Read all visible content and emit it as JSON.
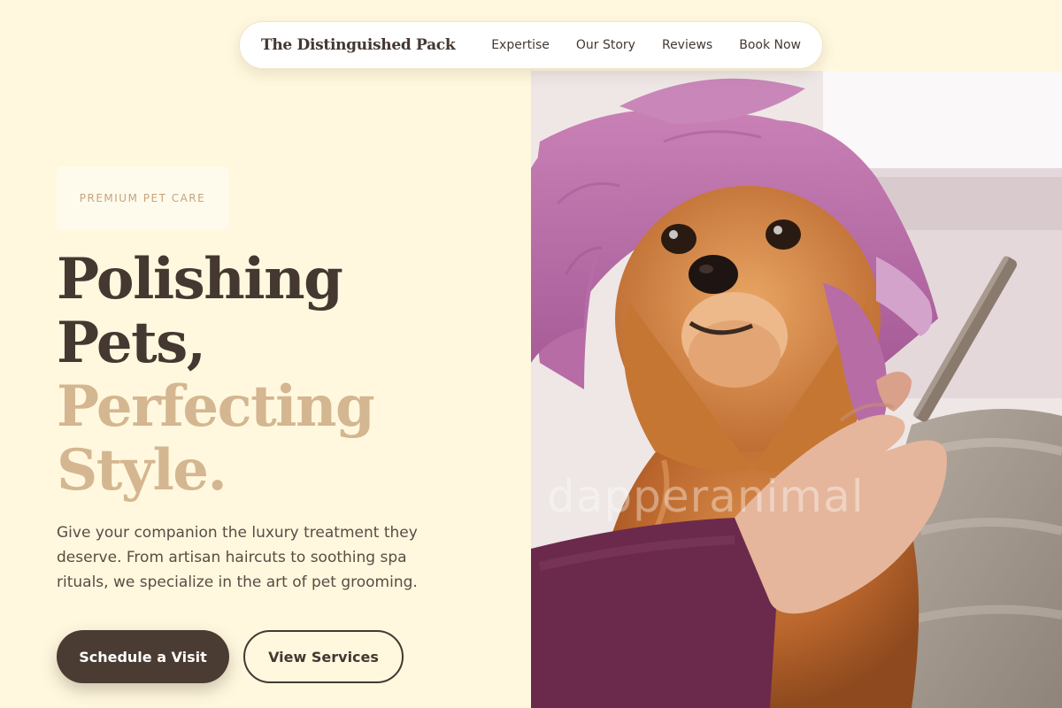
{
  "header": {
    "brand": "The Distinguished Pack",
    "links": [
      "Expertise",
      "Our Story",
      "Reviews",
      "Book Now"
    ]
  },
  "hero": {
    "eyebrow": "PREMIUM PET CARE",
    "headline": {
      "line1": "Polishing",
      "line2": "Pets,",
      "line3": "Perfecting",
      "line4": "Style."
    },
    "description": "Give your companion the luxury treatment they deserve. From artisan haircuts to soothing spa rituals, we specialize in the art of pet grooming.",
    "primary_button": "Schedule a Visit",
    "secondary_button": "View Services",
    "image": {
      "subject": "pomeranian-with-towel-being-groomed",
      "watermark": "dapperanimal"
    }
  },
  "colors": {
    "background": "#FFF8DE",
    "text_dark": "#443831",
    "accent": "#D4B690",
    "button_dark": "#4A3B33"
  }
}
